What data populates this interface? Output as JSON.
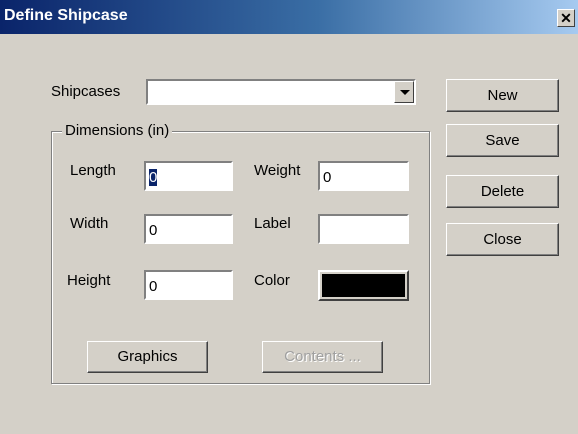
{
  "window": {
    "title": "Define Shipcase",
    "close_glyph": "✕"
  },
  "shipcases": {
    "label": "Shipcases",
    "selected_value": ""
  },
  "dimensions": {
    "legend": "Dimensions (in)",
    "length": {
      "label": "Length",
      "value": "0"
    },
    "width": {
      "label": "Width",
      "value": "0"
    },
    "height": {
      "label": "Height",
      "value": "0"
    },
    "weight": {
      "label": "Weight",
      "value": "0"
    },
    "label_field": {
      "label": "Label",
      "value": ""
    },
    "color": {
      "label": "Color",
      "swatch": "#000000"
    },
    "graphics_button": "Graphics",
    "contents_button": "Contents ..."
  },
  "buttons": {
    "new": "New",
    "save": "Save",
    "delete": "Delete",
    "close": "Close"
  },
  "colors": {
    "face": "#d4d0c8",
    "title_start": "#0a246a",
    "title_end": "#a6caf0"
  }
}
